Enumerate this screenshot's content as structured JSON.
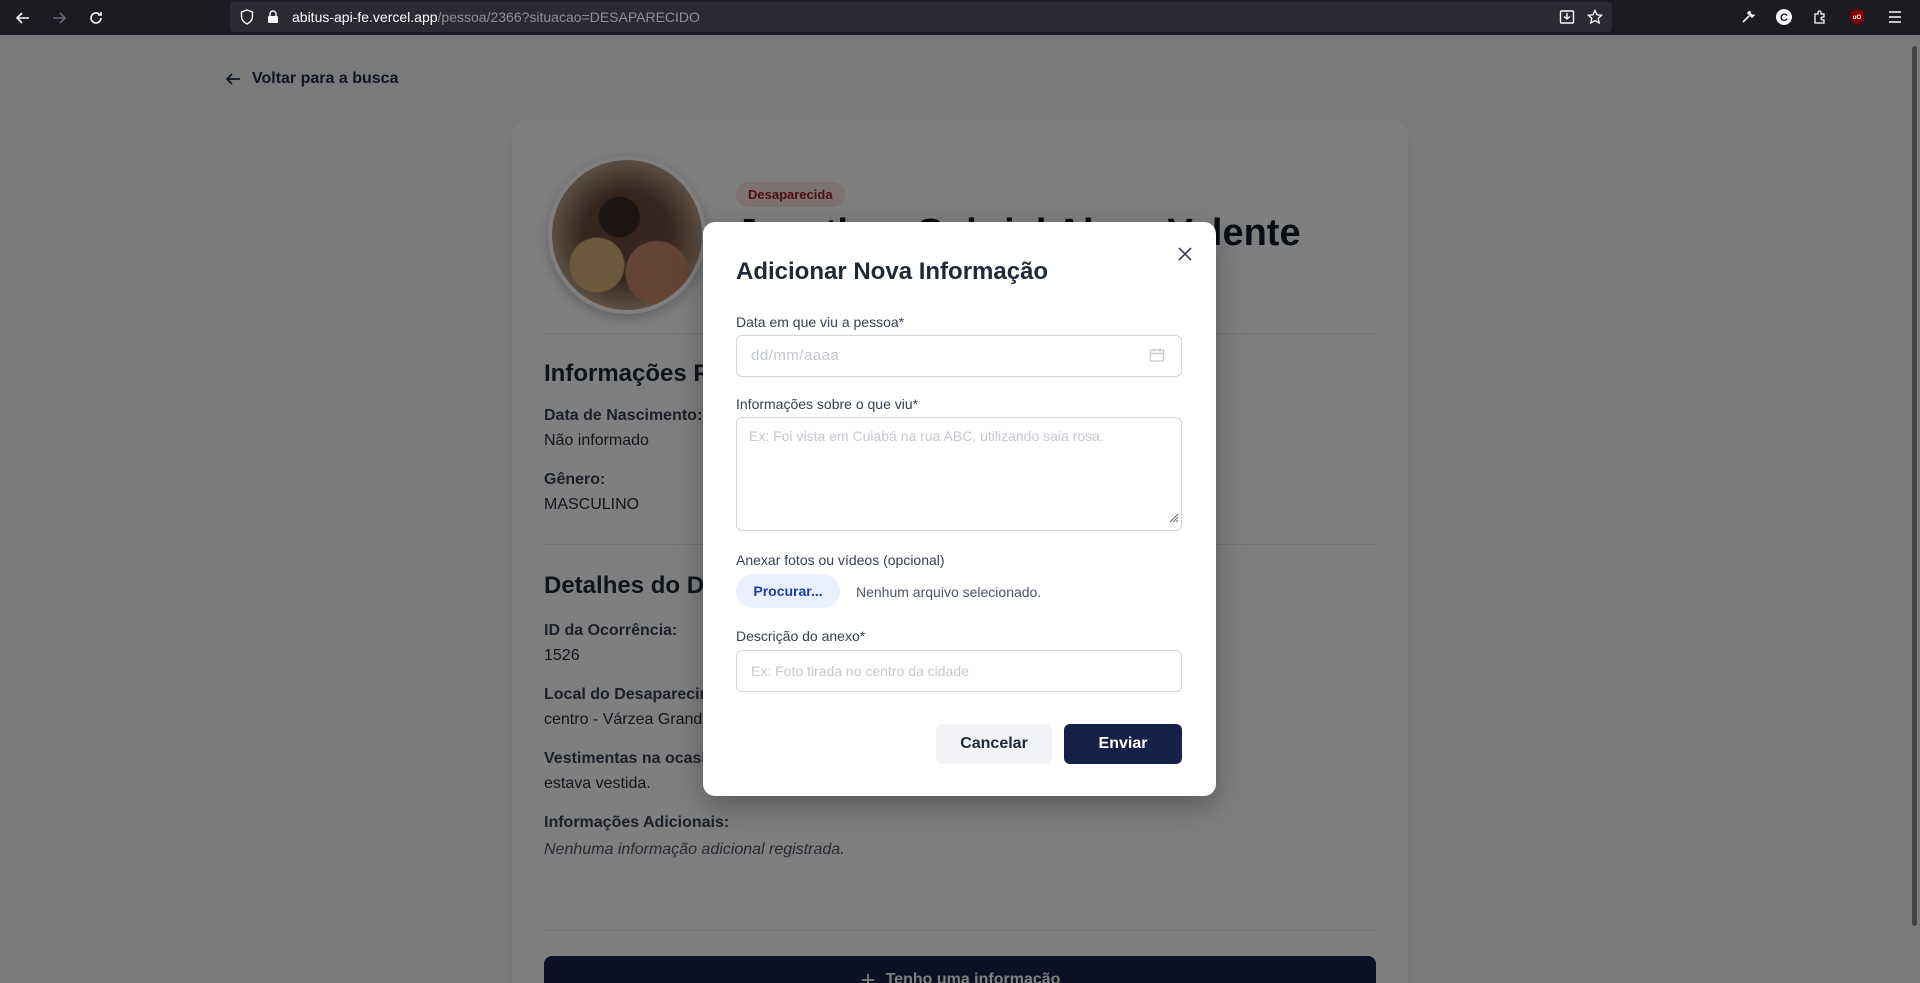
{
  "browser": {
    "url_host": "abitus-api-fe.vercel.app",
    "url_path": "/pessoa/2366?situacao=DESAPARECIDO"
  },
  "page": {
    "back_label": "Voltar para a busca",
    "badge": "Desaparecida",
    "person_name": "Jonathan Gabriel Alves Valente",
    "personal_title": "Informações Pessoais",
    "birth_label": "Data de Nascimento:",
    "birth_value": "Não informado",
    "gender_label": "Gênero:",
    "gender_value": "MASCULINO",
    "details_title": "Detalhes do Desaparecimento",
    "occurrence_label": "ID da Ocorrência:",
    "occurrence_value": "1526",
    "location_label": "Local do Desaparecimento:",
    "location_value": "centro - Várzea Grande",
    "clothes_label": "Vestimentas na ocasião:",
    "clothes_value": "estava vestida.",
    "additional_label": "Informações Adicionais:",
    "additional_value": "Nenhuma informação adicional registrada.",
    "info_button": "Tenho uma informação"
  },
  "modal": {
    "title": "Adicionar Nova Informação",
    "date_label": "Data em que viu a pessoa*",
    "date_placeholder": "dd/mm/aaaa",
    "info_label": "Informações sobre o que viu*",
    "info_placeholder": "Ex: Foi vista em Cuiabá na rua ABC, utilizando saia rosa.",
    "attach_label": "Anexar fotos ou vídeos (opcional)",
    "browse_button": "Procurar...",
    "file_status": "Nenhum arquivo selecionado.",
    "attach_desc_label": "Descrição do anexo*",
    "attach_desc_placeholder": "Ex: Foto tirada no centro da cidade",
    "cancel_button": "Cancelar",
    "send_button": "Enviar"
  },
  "colors": {
    "primary": "#16214a",
    "badge_bg": "#fde2e2",
    "badge_text": "#9b1c1c",
    "browse_bg": "#eaf0ff",
    "browse_text": "#1d3fa8"
  }
}
